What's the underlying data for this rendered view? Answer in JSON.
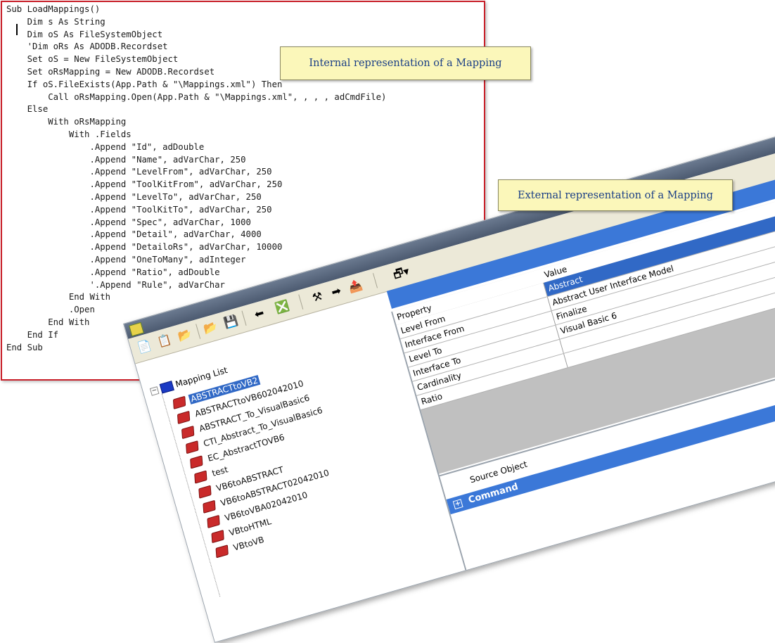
{
  "code": {
    "lines": [
      "Sub LoadMappings()",
      "    Dim s As String",
      "    Dim oS As FileSystemObject",
      "",
      "    'Dim oRs As ADODB.Recordset",
      "",
      "    Set oS = New FileSystemObject",
      "    Set oRsMapping = New ADODB.Recordset",
      "    If oS.FileExists(App.Path & \"\\Mappings.xml\") Then",
      "        Call oRsMapping.Open(App.Path & \"\\Mappings.xml\", , , , adCmdFile)",
      "    Else",
      "        With oRsMapping",
      "            With .Fields",
      "                .Append \"Id\", adDouble",
      "                .Append \"Name\", adVarChar, 250",
      "                .Append \"LevelFrom\", adVarChar, 250",
      "                .Append \"ToolKitFrom\", adVarChar, 250",
      "                .Append \"LevelTo\", adVarChar, 250",
      "                .Append \"ToolKitTo\", adVarChar, 250",
      "                .Append \"Spec\", adVarChar, 1000",
      "                .Append \"Detail\", adVarChar, 4000",
      "                .Append \"DetailoRs\", adVarChar, 10000",
      "                .Append \"OneToMany\", adInteger",
      "                .Append \"Ratio\", adDouble",
      "                '.Append \"Rule\", adVarChar",
      "            End With",
      "            .Open",
      "        End With",
      "    End If",
      "End Sub"
    ]
  },
  "callouts": {
    "internal": "Internal representation of a Mapping",
    "external": "External representation of a Mapping"
  },
  "app": {
    "tree": {
      "root": "Mapping List",
      "items": [
        "ABSTRACTtoVB2",
        "ABSTRACTtoVB602042010",
        "ABSTRACT_To_VisualBasic6",
        "CTI_Abstract_To_VisualBasic6",
        "EC_AbstractTOVB6",
        "test",
        "VB6toABSTRACT",
        "VB6toABSTRACT02042010",
        "VB6toVBA02042010",
        "VBtoHTML",
        "VBtoVB"
      ],
      "selected_index": 0
    },
    "properties": {
      "header_property": "Property",
      "header_value": "Value",
      "rows": [
        {
          "name": "Level From",
          "value": "Abstract"
        },
        {
          "name": "Interface From",
          "value": "Abstract User Interface Model"
        },
        {
          "name": "Level To",
          "value": "Finalize"
        },
        {
          "name": "Interface To",
          "value": "Visual Basic 6"
        },
        {
          "name": "Cardinality",
          "value": ""
        },
        {
          "name": "Ratio",
          "value": ""
        }
      ]
    },
    "source": {
      "label": "Source Object",
      "command": "Command"
    }
  }
}
